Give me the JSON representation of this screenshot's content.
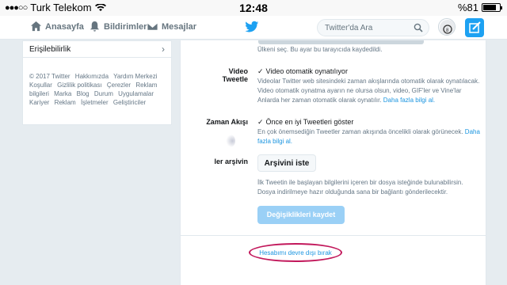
{
  "statusbar": {
    "carrier": "Turk Telekom",
    "time": "12:48",
    "battery": "%81",
    "battery_level": 0.81
  },
  "nav": {
    "home": "Anasayfa",
    "notifications": "Bildirimler",
    "messages": "Mesajlar",
    "search_placeholder": "Twitter'da Ara",
    "brand_color": "#1da1f2"
  },
  "sidebar": {
    "accessibility": "Erişilebilirlik",
    "links": [
      "© 2017 Twitter",
      "Hakkımızda",
      "Yardım Merkezi",
      "Koşullar",
      "Gizlilik politikası",
      "Çerezler",
      "Reklam bilgileri",
      "Marka",
      "Blog",
      "Durum",
      "Uygulamalar",
      "Kariyer",
      "Reklam",
      "İşletmeler",
      "Geliştiriciler"
    ]
  },
  "settings": {
    "country_note": "Ülkeni seç. Bu ayar bu tarayıcıda kaydedildi.",
    "video": {
      "label": "Video Tweetle",
      "checkbox": "Video otomatik oynatılıyor",
      "desc1": "Videolar Twitter web sitesindeki zaman akışlarında otomatik olarak oynatılacak.",
      "desc2": "Video otomatik oynatma ayarın ne olursa olsun, video, GIF'ler ve Vine'lar",
      "desc3": "Anlarda her zaman otomatik olarak oynatılır.",
      "more": "Daha fazla bilgi al."
    },
    "timeline": {
      "label": "Zaman Akışı",
      "checkbox": "Önce en iyi Tweetleri göster",
      "desc1": "En çok önemsediğin Tweetler zaman akışında öncelikli olarak görünecek.",
      "more1": "Daha",
      "more2": "fazla bilgi al."
    },
    "archive": {
      "label": "ler arşivin",
      "button": "Arşivini iste",
      "desc1": "İlk Tweetin ile başlayan bilgilerini içeren bir dosya isteğinde bulunabilirsin.",
      "desc2": "Dosya indirilmeye hazır olduğunda sana bir bağlantı gönderilecektir."
    },
    "save_button": "Değişiklikleri kaydet",
    "deactivate": "Hesabımı devre dışı bırak",
    "highlight_color": "#c2185b"
  }
}
